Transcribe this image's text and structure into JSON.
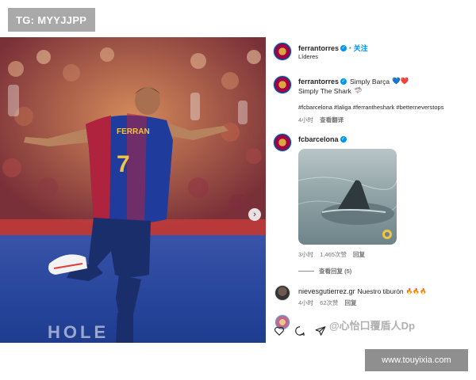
{
  "tag": "TG: MYYJJPP",
  "post": {
    "author": "ferrantorres",
    "follow_label": "关注",
    "subtitle": "Líderes",
    "next_icon": "chevron-right-icon",
    "pitch_board_text": "HOLE"
  },
  "caption": {
    "author": "ferrantorres",
    "text": "Simply Barça",
    "emojis": "💙❤️",
    "line2": "Simply The Shark",
    "shark_emoji": "🦈",
    "hashtags": "#fcbarcelona #laliga #ferrantheshark #betterneverstops",
    "time": "4小时",
    "translate": "查看翻译"
  },
  "comments": [
    {
      "author": "fcbarcelona",
      "time": "3小时",
      "likes": "1,465次赞",
      "reply": "回复",
      "view_replies": "查看回复 (5)"
    },
    {
      "author": "nievesgutierrez.gr",
      "text": "Nuestro tiburón",
      "emojis": "🔥🔥🔥",
      "time": "4小时",
      "likes": "62次赞",
      "reply": "回复"
    }
  ],
  "actions": [
    "heart-icon",
    "comment-icon",
    "share-icon"
  ],
  "watermark": "@心怡口覆盾人Dp",
  "site_url": "www.touyixia.com",
  "colors": {
    "link": "#0095f6",
    "barca_blue": "#004d98",
    "barca_red": "#a50044",
    "badge_gray": "#a9a9a9"
  }
}
